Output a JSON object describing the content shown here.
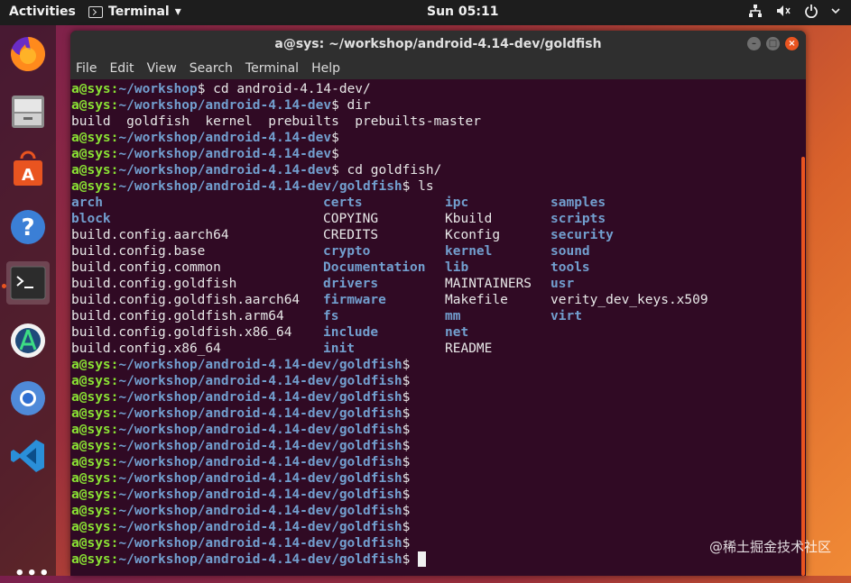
{
  "topbar": {
    "activities": "Activities",
    "app_name": "Terminal",
    "app_menu_arrow": "▾",
    "clock": "Sun 05:11",
    "tray_icons": [
      "network-icon",
      "volume-icon",
      "power-icon"
    ]
  },
  "dock": {
    "items": [
      "firefox",
      "files",
      "software",
      "help",
      "terminal",
      "android-studio",
      "chromium",
      "vscode"
    ],
    "show_apps": "•••"
  },
  "window": {
    "title": "a@sys: ~/workshop/android-4.14-dev/goldfish",
    "buttons": [
      "–",
      "□",
      "×"
    ],
    "menu": [
      "File",
      "Edit",
      "View",
      "Search",
      "Terminal",
      "Help"
    ]
  },
  "terminal": {
    "prompt_user": "a@sys",
    "lines_before": [
      {
        "path": "~/workshop",
        "cmd": " cd android-4.14-dev/"
      },
      {
        "path": "~/workshop/android-4.14-dev",
        "cmd": " dir"
      },
      {
        "text": "build  goldfish  kernel  prebuilts  prebuilts-master"
      },
      {
        "path": "~/workshop/android-4.14-dev",
        "cmd": ""
      },
      {
        "path": "~/workshop/android-4.14-dev",
        "cmd": ""
      },
      {
        "path": "~/workshop/android-4.14-dev",
        "cmd": " cd goldfish/"
      },
      {
        "path": "~/workshop/android-4.14-dev/goldfish",
        "cmd": " ls"
      }
    ],
    "ls_columns": [
      [
        {
          "n": "arch",
          "d": true
        },
        {
          "n": "block",
          "d": true
        },
        {
          "n": "build.config.aarch64",
          "d": false
        },
        {
          "n": "build.config.base",
          "d": false
        },
        {
          "n": "build.config.common",
          "d": false
        },
        {
          "n": "build.config.goldfish",
          "d": false
        },
        {
          "n": "build.config.goldfish.aarch64",
          "d": false
        },
        {
          "n": "build.config.goldfish.arm64",
          "d": false
        },
        {
          "n": "build.config.goldfish.x86_64",
          "d": false
        },
        {
          "n": "build.config.x86_64",
          "d": false
        }
      ],
      [
        {
          "n": "certs",
          "d": true
        },
        {
          "n": "COPYING",
          "d": false
        },
        {
          "n": "CREDITS",
          "d": false
        },
        {
          "n": "crypto",
          "d": true
        },
        {
          "n": "Documentation",
          "d": true
        },
        {
          "n": "drivers",
          "d": true
        },
        {
          "n": "firmware",
          "d": true
        },
        {
          "n": "fs",
          "d": true
        },
        {
          "n": "include",
          "d": true
        },
        {
          "n": "init",
          "d": true
        }
      ],
      [
        {
          "n": "ipc",
          "d": true
        },
        {
          "n": "Kbuild",
          "d": false
        },
        {
          "n": "Kconfig",
          "d": false
        },
        {
          "n": "kernel",
          "d": true
        },
        {
          "n": "lib",
          "d": true
        },
        {
          "n": "MAINTAINERS",
          "d": false
        },
        {
          "n": "Makefile",
          "d": false
        },
        {
          "n": "mm",
          "d": true
        },
        {
          "n": "net",
          "d": true
        },
        {
          "n": "README",
          "d": false
        }
      ],
      [
        {
          "n": "samples",
          "d": true
        },
        {
          "n": "scripts",
          "d": true
        },
        {
          "n": "security",
          "d": true
        },
        {
          "n": "sound",
          "d": true
        },
        {
          "n": "tools",
          "d": true
        },
        {
          "n": "usr",
          "d": true
        },
        {
          "n": "verity_dev_keys.x509",
          "d": false
        },
        {
          "n": "virt",
          "d": true
        }
      ]
    ],
    "trailing_prompt_path": "~/workshop/android-4.14-dev/goldfish",
    "trailing_prompt_count": 13
  },
  "watermark": "@稀土掘金技术社区",
  "colors": {
    "accent": "#e95420",
    "prompt_user": "#8ae234",
    "prompt_path": "#729fcf",
    "terminal_bg": "#300a24"
  }
}
